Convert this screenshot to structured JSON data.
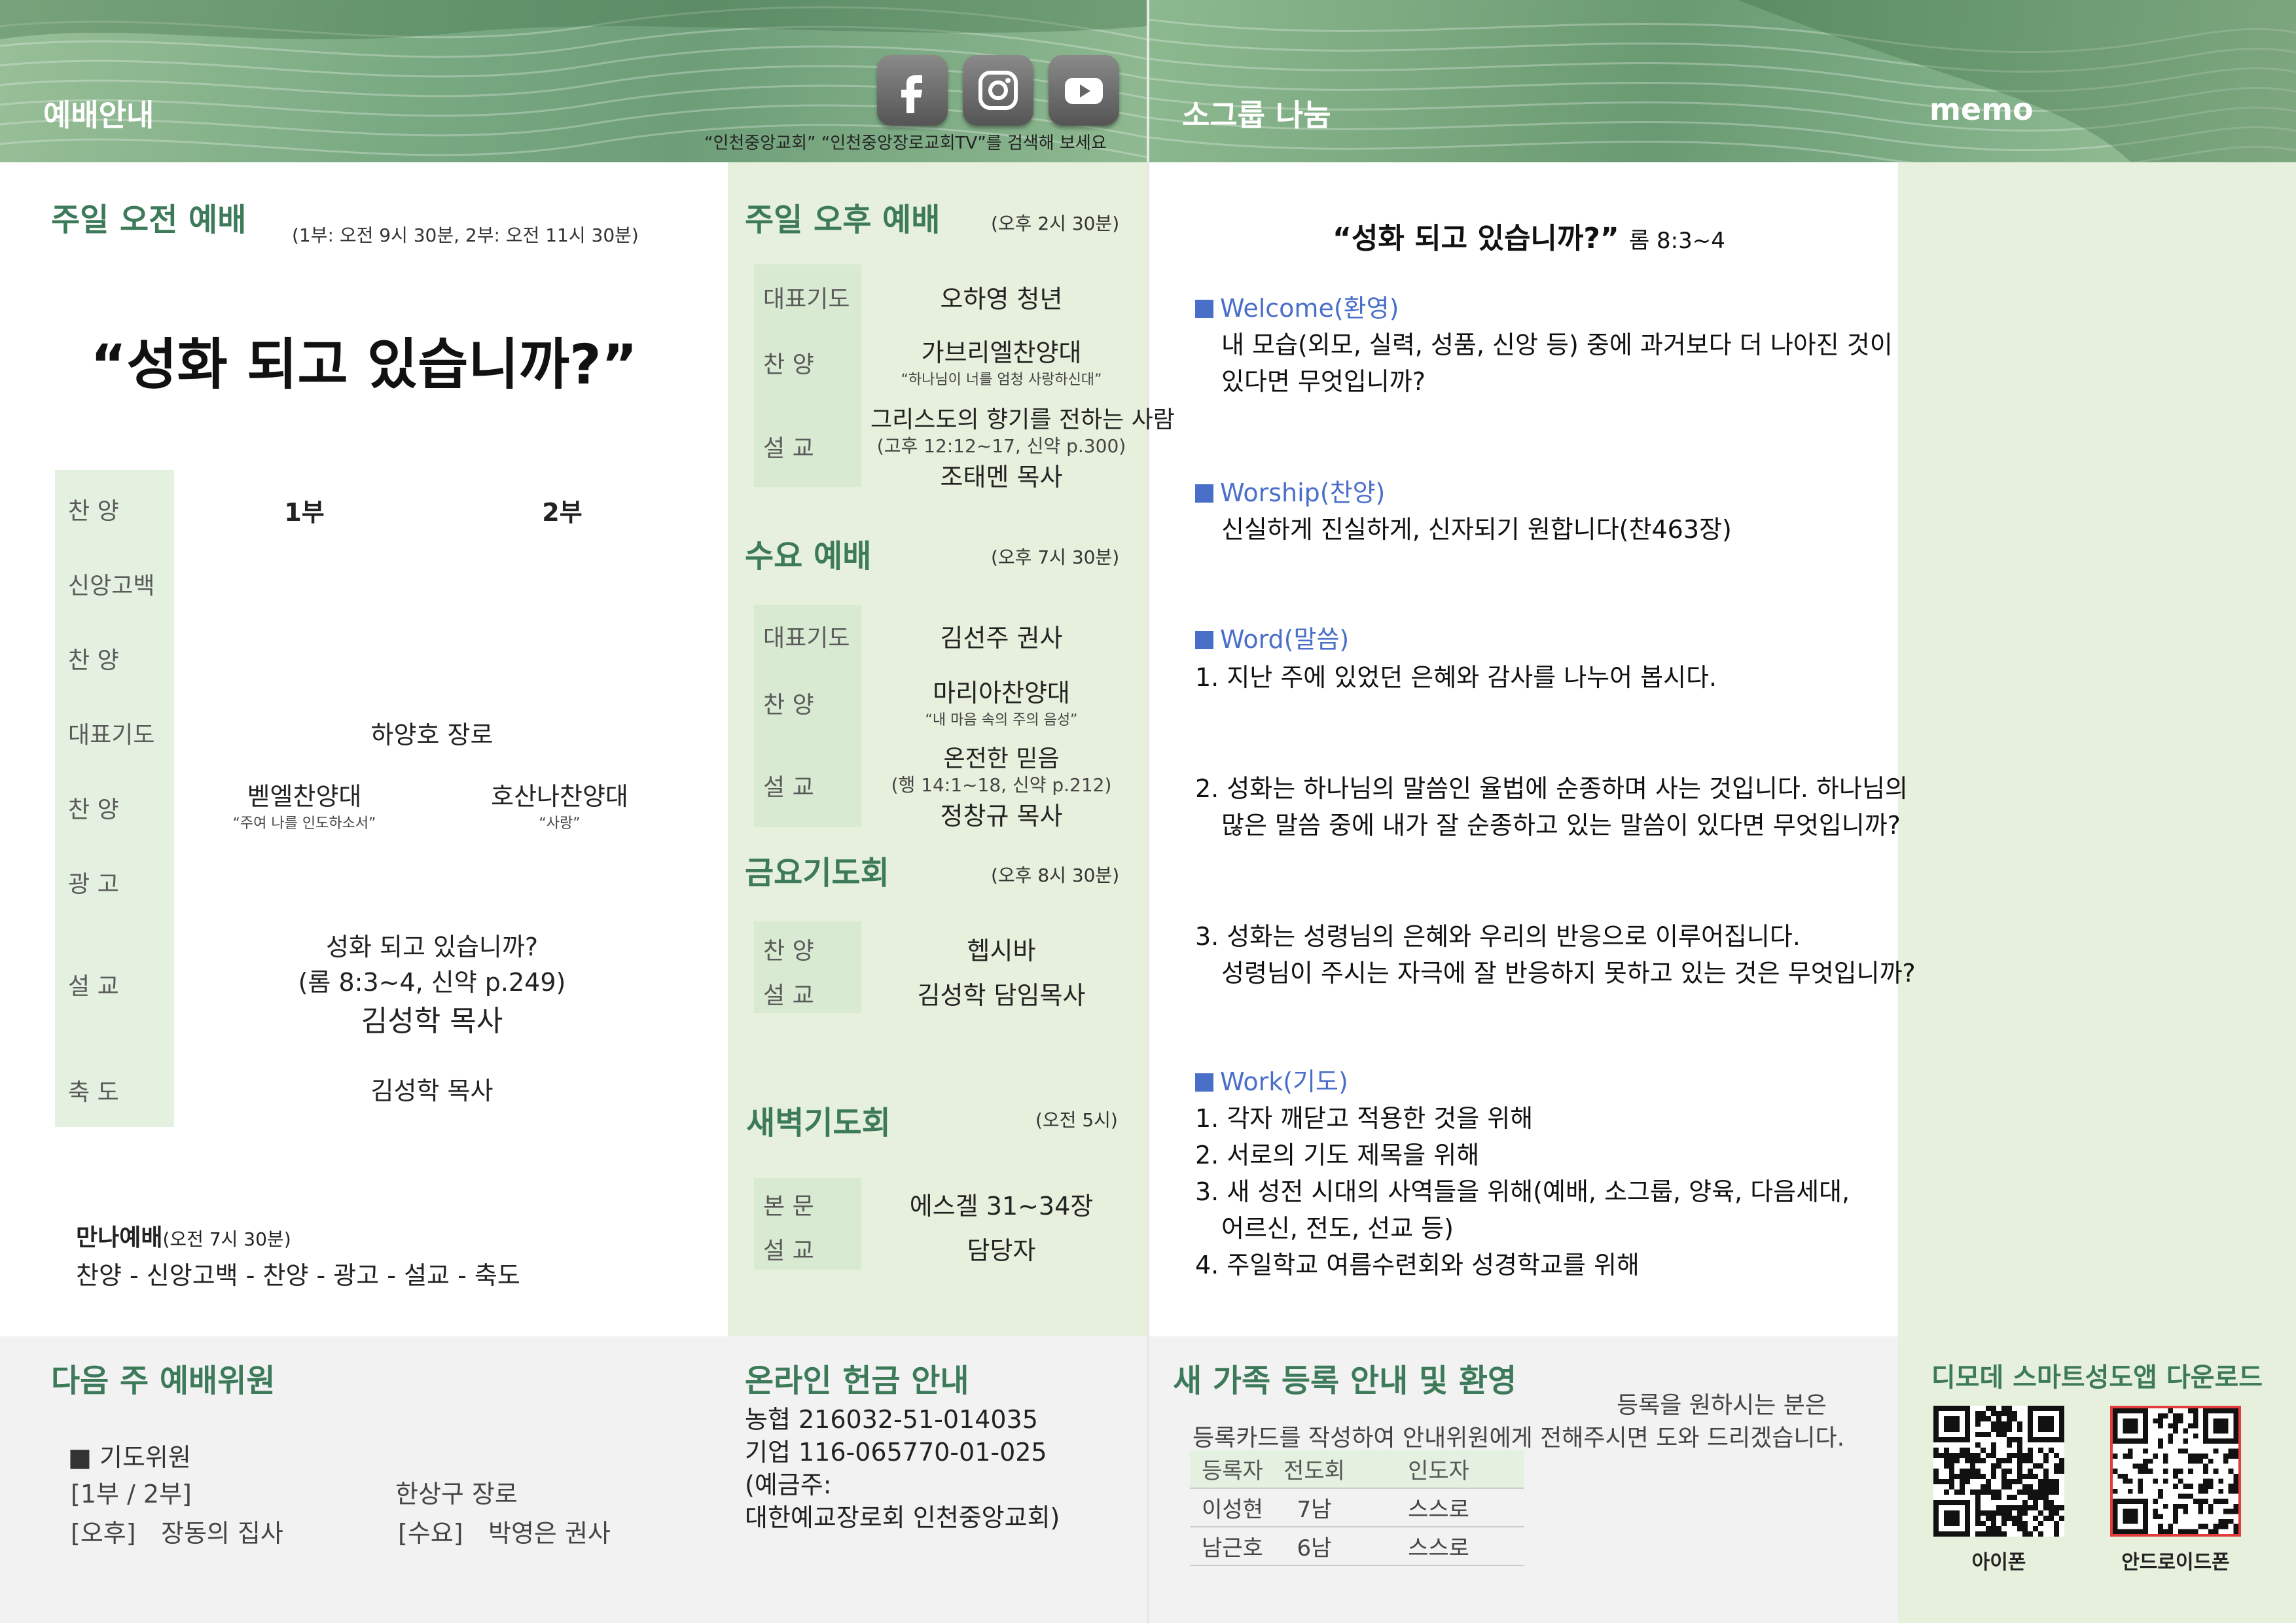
{
  "header": {
    "left_title": "예배안내",
    "search_hint": "“인천중앙교회” “인천중앙장로교회TV”를 검색해 보세요",
    "social_icons": [
      "facebook-icon",
      "instagram-icon",
      "youtube-icon"
    ],
    "right_title": "소그룹 나눔",
    "memo_title": "memo"
  },
  "morning": {
    "title": "주일 오전 예배",
    "time": "(1부: 오전 9시 30분, 2부: 오전 11시 30분)",
    "sermon_title": "“성화  되고  있습니까?”",
    "labels": [
      "찬     양",
      "신앙고백",
      "찬     양",
      "대표기도",
      "찬     양",
      "광     고",
      "설     교",
      "축     도"
    ],
    "col1": "1부",
    "col2": "2부",
    "prayer": "하양호  장로",
    "choir1": "벧엘찬양대",
    "choir1_song": "“주여  나를  인도하소서”",
    "choir2": "호산나찬양대",
    "choir2_song": "“사랑”",
    "sermon": "성화  되고  있습니까?",
    "sermon_ref": "(롬  8:3~4,  신약  p.249)",
    "preacher": "김성학  목사",
    "benediction": "김성학  목사"
  },
  "manna": {
    "title": "만나예배",
    "time": "(오전 7시 30분)",
    "order": "찬양  -  신앙고백  -  찬양  -  광고  -  설교  -  축도"
  },
  "afternoon": {
    "title": "주일 오후 예배",
    "time": "(오후 2시 30분)",
    "labels": [
      "대표기도",
      "찬     양",
      "설     교"
    ],
    "prayer": "오하영  청년",
    "choir": "가브리엘찬양대",
    "choir_song": "“하나님이  너를  엄청  사랑하신대”",
    "sermon": "그리스도의 향기를 전하는 사람",
    "sermon_ref": "(고후  12:12~17,  신약  p.300)",
    "preacher": "조태멘  목사"
  },
  "wednesday": {
    "title": "수요 예배",
    "time": "(오후 7시 30분)",
    "labels": [
      "대표기도",
      "찬     양",
      "설     교"
    ],
    "prayer": "김선주  권사",
    "choir": "마리아찬양대",
    "choir_song": "“내  마음  속의  주의  음성”",
    "sermon": "온전한  믿음",
    "sermon_ref": "(행  14:1~18,  신약  p.212)",
    "preacher": "정창규  목사"
  },
  "friday": {
    "title": "금요기도회",
    "time": "(오후 8시 30분)",
    "labels": [
      "찬     양",
      "설     교"
    ],
    "praise": "헵시바",
    "preacher": "김성학  담임목사"
  },
  "dawn": {
    "title": "새벽기도회",
    "time": "(오전 5시)",
    "labels": [
      "본     문",
      "설     교"
    ],
    "passage": "에스겔  31~34장",
    "preacher": "담당자"
  },
  "next_week": {
    "title": "다음 주 예배위원",
    "sub": "■  기도위원",
    "r1_label": "[1부  /  2부]",
    "r1_value": "한상구  장로",
    "r2_label": "[오후]",
    "r2_value": "장동의  집사",
    "r3_label": "[수요]",
    "r3_value": "박영은  권사"
  },
  "offering": {
    "title": "온라인 헌금 안내",
    "line1": "농협  216032-51-014035",
    "line2": "기업  116-065770-01-025",
    "line3": "(예금주:",
    "line4": "대한예교장로회 인천중앙교회)"
  },
  "smallgroup": {
    "title": "“성화 되고 있습니까?”",
    "ref": "롬 8:3~4",
    "welcome_h": "Welcome(환영)",
    "welcome_1": "내 모습(외모, 실력, 성품, 신앙 등) 중에 과거보다 더 나아진 것이",
    "welcome_2": "있다면 무엇입니까?",
    "worship_h": "Worship(찬양)",
    "worship_1": "신실하게 진실하게, 신자되기 원합니다(찬463장)",
    "word_h": "Word(말씀)",
    "word_1": "1. 지난 주에 있었던 은혜와 감사를 나누어 봅시다.",
    "word_2a": "2.  성화는 하나님의 말씀인 율법에 순종하며 사는 것입니다. 하나님의",
    "word_2b": "많은 말씀 중에 내가 잘 순종하고 있는 말씀이 있다면 무엇입니까?",
    "word_3a": "3. 성화는 성령님의 은혜와 우리의 반응으로 이루어집니다.",
    "word_3b": "성령님이 주시는 자극에 잘 반응하지 못하고 있는 것은 무엇입니까?",
    "work_h": "Work(기도)",
    "work_1": "1. 각자 깨닫고 적용한 것을 위해",
    "work_2": "2. 서로의 기도 제목을 위해",
    "work_3a": "3. 새 성전 시대의 사역들을 위해(예배, 소그룹, 양육, 다음세대,",
    "work_3b": "어르신, 전도, 선교 등)",
    "work_4": "4. 주일학교 여름수련회와 성경학교를 위해"
  },
  "newfamily": {
    "title": "새 가족 등록 안내 및 환영",
    "line1": "등록을 원하시는 분은",
    "line2": "등록카드를 작성하여 안내위원에게 전해주시면 도와 드리겠습니다.",
    "headers": [
      "등록자",
      "전도회",
      "인도자"
    ],
    "rows": [
      [
        "이성현",
        "7남",
        "스스로"
      ],
      [
        "남근호",
        "6남",
        "스스로"
      ]
    ]
  },
  "app": {
    "title": "디모데 스마트성도앱 다운로드",
    "iphone": "아이폰",
    "android": "안드로이드폰"
  },
  "colors": {
    "accent_green": "#3d7a5a",
    "panel_green": "#e6f0dc",
    "panel_gray": "#f2f2f2",
    "step_blue": "#4a6fc9"
  }
}
